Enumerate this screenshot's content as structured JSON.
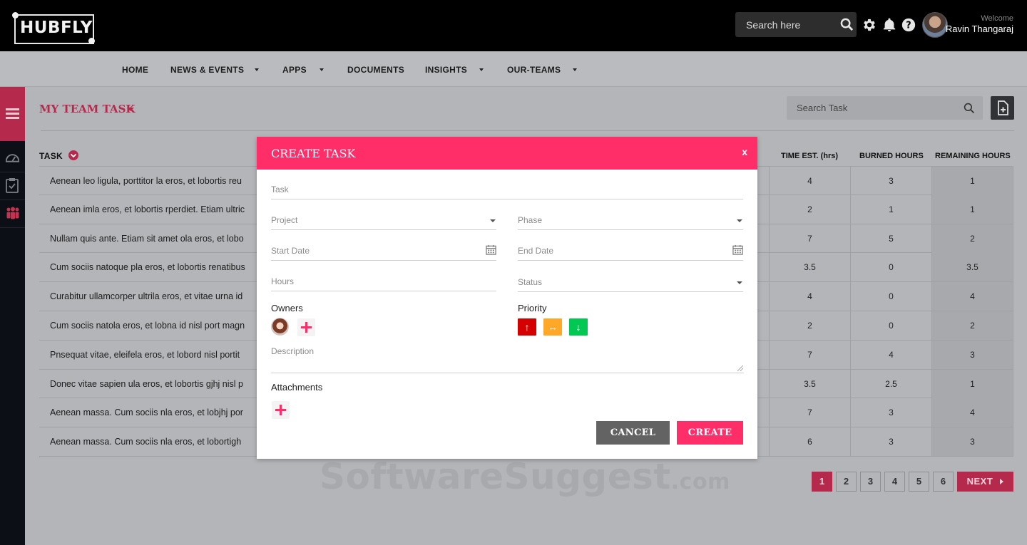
{
  "header": {
    "logo": "HUBFLY",
    "search_placeholder": "Search here",
    "welcome": "Welcome",
    "user_name": "Ravin Thangaraj"
  },
  "nav": {
    "items": [
      "HOME",
      "NEWS & EVENTS",
      "APPS",
      "DOCUMENTS",
      "INSIGHTS",
      "OUR-TEAMS"
    ]
  },
  "page": {
    "title": "MY TEAM TASK",
    "search_placeholder": "Search Task"
  },
  "table": {
    "headers": {
      "task": "TASK",
      "est": "TIME EST. (hrs)",
      "burned": "BURNED HOURS",
      "remaining": "REMAINING HOURS"
    },
    "rows": [
      {
        "task": "Aenean leo ligula, porttitor la eros, et lobortis reu",
        "est": "4",
        "burned": "3",
        "remaining": "1"
      },
      {
        "task": "Aenean imla eros, et lobortis rperdiet. Etiam ultric",
        "est": "2",
        "burned": "1",
        "remaining": "1"
      },
      {
        "task": "Nullam quis ante. Etiam sit amet ola eros, et lobo",
        "est": "7",
        "burned": "5",
        "remaining": "2"
      },
      {
        "task": "Cum sociis natoque pla eros, et lobortis renatibus",
        "est": "3.5",
        "burned": "0",
        "remaining": "3.5"
      },
      {
        "task": "Curabitur ullamcorper ultrila eros, et vitae urna id",
        "est": "4",
        "burned": "0",
        "remaining": "4"
      },
      {
        "task": "Cum sociis natola eros, et lobna id nisl port magn",
        "est": "2",
        "burned": "0",
        "remaining": "2"
      },
      {
        "task": "Pnsequat vitae, eleifela eros, et lobord nisl portit",
        "est": "7",
        "burned": "4",
        "remaining": "3"
      },
      {
        "task": "Donec vitae sapien ula eros, et lobortis gjhj nisl p",
        "est": "3.5",
        "burned": "2.5",
        "remaining": "1"
      },
      {
        "task": "Aenean massa. Cum sociis nla eros, et lobjhj por",
        "est": "7",
        "burned": "3",
        "remaining": "4"
      },
      {
        "task": "Aenean massa. Cum sociis nla eros, et lobortigh",
        "est": "6",
        "burned": "3",
        "remaining": "3"
      }
    ]
  },
  "pagination": {
    "pages": [
      "1",
      "2",
      "3",
      "4",
      "5",
      "6"
    ],
    "active": "1",
    "next": "NEXT"
  },
  "watermark": {
    "main": "SoftwareSuggest",
    "suffix": ".com"
  },
  "modal": {
    "title": "CREATE TASK",
    "close": "x",
    "task_placeholder": "Task",
    "project_placeholder": "Project",
    "phase_placeholder": "Phase",
    "start_placeholder": "Start Date",
    "end_placeholder": "End Date",
    "hours_placeholder": "Hours",
    "status_placeholder": "Status",
    "owners_label": "Owners",
    "priority_label": "Priority",
    "description_placeholder": "Description",
    "attachments_label": "Attachments",
    "cancel": "CANCEL",
    "create": "CREATE"
  },
  "colors": {
    "accent": "#ff2d68",
    "accent_dim": "#b52a4c",
    "priority_high": "#d50000",
    "priority_mid": "#ffa726",
    "priority_low": "#00c853"
  },
  "icons": [
    "search-icon",
    "gear-icon",
    "bell-icon",
    "help-icon",
    "menu-icon",
    "dashboard-icon",
    "clipboard-icon",
    "team-icon",
    "add-file-icon",
    "calendar-icon",
    "arrow-up-icon",
    "arrow-both-icon",
    "arrow-down-icon",
    "plus-icon"
  ]
}
